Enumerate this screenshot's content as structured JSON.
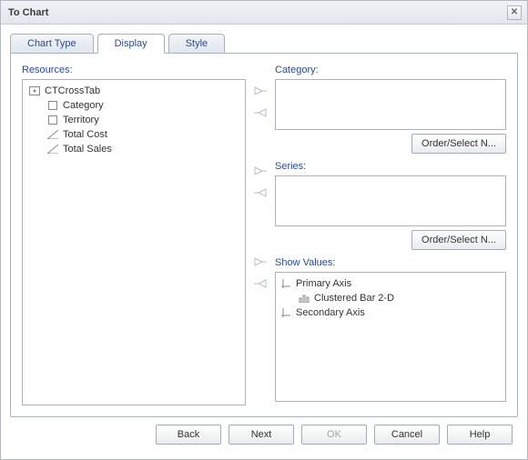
{
  "window": {
    "title": "To Chart",
    "close_glyph": "✕"
  },
  "tabs": [
    {
      "label": "Chart Type"
    },
    {
      "label": "Display"
    },
    {
      "label": "Style"
    }
  ],
  "labels": {
    "resources": "Resources:",
    "category": "Category:",
    "series": "Series:",
    "show_values": "Show Values:"
  },
  "resources": {
    "root": "CTCrossTab",
    "items": [
      {
        "name": "Category",
        "icon": "field"
      },
      {
        "name": "Territory",
        "icon": "field"
      },
      {
        "name": "Total Cost",
        "icon": "measure"
      },
      {
        "name": "Total Sales",
        "icon": "measure"
      }
    ]
  },
  "buttons": {
    "order_select": "Order/Select N...",
    "back": "Back",
    "next": "Next",
    "ok": "OK",
    "cancel": "Cancel",
    "help": "Help"
  },
  "show_values": {
    "primary": "Primary Axis",
    "series": "Clustered Bar 2-D",
    "secondary": "Secondary Axis"
  }
}
